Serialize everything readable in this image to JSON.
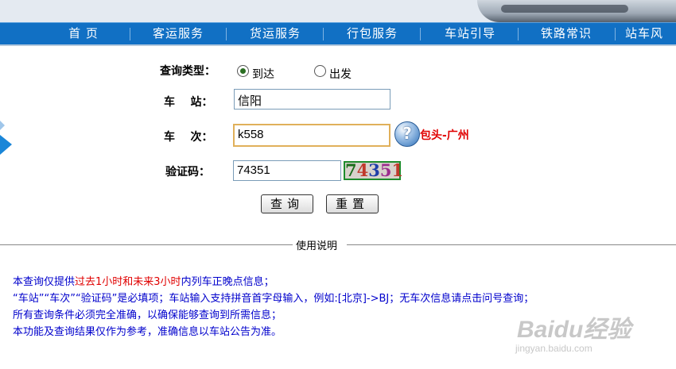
{
  "nav": {
    "items": [
      "首 页",
      "客运服务",
      "货运服务",
      "行包服务",
      "车站引导",
      "铁路常识",
      "站车风"
    ]
  },
  "form": {
    "type_label": "查询类型：",
    "type_options": [
      "到达",
      "出发"
    ],
    "type_selected": "到达",
    "station_label": "车    站：",
    "station_value": "信阳",
    "train_label": "车    次：",
    "train_value": "k558",
    "route_text": "包头-广州",
    "code_label": "验证码：",
    "code_value": "74351",
    "captcha_text": "74351",
    "help_glyph": "?"
  },
  "buttons": {
    "query": "查询",
    "reset": "重置"
  },
  "instructions": {
    "title": "使用说明",
    "line1_a": "本查询仅提供",
    "line1_b": "过去1小时和未来3小时",
    "line1_c": "内列车正晚点信息；",
    "line2": "“车站”“车次”“验证码”是必填项；车站输入支持拼音首字母输入，例如:[北京]->BJ；无车次信息请点击问号查询；",
    "line3": "所有查询条件必须完全准确，以确保能够查询到所需信息；",
    "line4": "本功能及查询结果仅作为参考，准确信息以车站公告为准。"
  },
  "watermark": {
    "main": "Baidu经验",
    "url": "jingyan.baidu.com"
  },
  "colors": {
    "nav_bg": "#1170c4",
    "notes": "#0000cc",
    "highlight": "#e00000",
    "captcha_border": "#1e8c2c"
  }
}
